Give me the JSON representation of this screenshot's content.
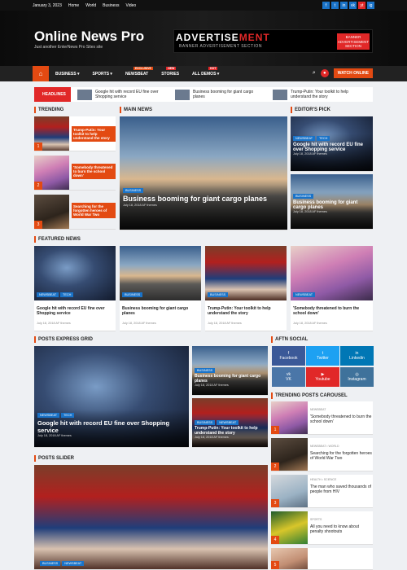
{
  "topbar": {
    "date": "January 3, 2023",
    "links": [
      "Home",
      "World",
      "Business",
      "Video"
    ],
    "social": [
      "f",
      "t",
      "in",
      "vk",
      "yt",
      "ig"
    ]
  },
  "header": {
    "site_title": "Online News Pro",
    "tagline": "Just another EnterNews Pro Sites site",
    "ad_title_a": "ADVERTISE",
    "ad_title_b": "MENT",
    "ad_sub": "BANNER ADVERTISEMENT SECTION",
    "ad_badge": "BANNER ADVERTISEMENT SECTION"
  },
  "nav": {
    "home_icon": "⌂",
    "items": [
      "BUSINESS",
      "SPORTS",
      "NEWSBEAT",
      "STORIES",
      "ALL DEMOS"
    ],
    "badges": {
      "exclusive": "EXCLUSIVE",
      "new": "NEW",
      "hot": "HOT"
    },
    "watch": "WATCH ONLINE"
  },
  "ticker": {
    "label": "HEADLINES",
    "items": [
      "Google hit with record EU fine over Shopping service",
      "Business booming for giant cargo planes",
      "Trump-Putin: Your toolkit to help understand the story"
    ]
  },
  "sections": {
    "trending": "TRENDING",
    "main": "MAIN NEWS",
    "editors": "EDITOR'S PICK",
    "featured": "FEATURED NEWS",
    "express": "POSTS EXPRESS GRID",
    "aftn": "AFTN SOCIAL",
    "carousel": "TRENDING POSTS CAROUSEL",
    "slider": "POSTS SLIDER"
  },
  "trending": [
    {
      "n": "1",
      "title": "Trump-Putin: Your toolkit to help understand the story"
    },
    {
      "n": "2",
      "title": "'Somebody threatened to burn the school down'"
    },
    {
      "n": "3",
      "title": "Searching for the forgotten heroes of World War Two"
    }
  ],
  "main": {
    "cat": "BUSINESS",
    "title": "Business booming for giant cargo planes",
    "meta": "July 18, 2018   AF themes"
  },
  "editors": [
    {
      "cats": [
        "NEWSBEAT",
        "TECH"
      ],
      "title": "Google hit with record EU fine over Shopping service",
      "meta": "July 18, 2018   AF themes"
    },
    {
      "cats": [
        "BUSINESS"
      ],
      "title": "Business booming for giant cargo planes",
      "meta": "July 18, 2018   AF themes"
    }
  ],
  "featured": [
    {
      "cats": [
        "NEWSBEAT",
        "TECH"
      ],
      "title": "Google hit with record EU fine over Shopping service",
      "meta": "July 18, 2018   AF themes"
    },
    {
      "cats": [
        "BUSINESS"
      ],
      "title": "Business booming for giant cargo planes",
      "meta": "July 18, 2018   AF themes"
    },
    {
      "cats": [
        "BUSINESS"
      ],
      "title": "Trump-Putin: Your toolkit to help understand the story",
      "meta": "July 18, 2018   AF themes"
    },
    {
      "cats": [
        "NEWSBEAT"
      ],
      "title": "'Somebody threatened to burn the school down'",
      "meta": "July 18, 2018   AF themes"
    }
  ],
  "express": {
    "big": {
      "cats": [
        "NEWSBEAT",
        "TECH"
      ],
      "title": "Google hit with record EU fine over Shopping service",
      "meta": "July 18, 2018   AF themes"
    },
    "small": [
      {
        "cats": [
          "BUSINESS"
        ],
        "title": "Business booming for giant cargo planes",
        "meta": "July 18, 2018   AF themes"
      },
      {
        "cats": [
          "BUSINESS",
          "NEWSBEAT"
        ],
        "title": "Trump-Putin: Your toolkit to help understand the story",
        "meta": "July 18, 2018   AF themes"
      }
    ]
  },
  "social_buttons": [
    {
      "label": "Facebook",
      "icon": "f",
      "color": "#3b5998"
    },
    {
      "label": "Twitter",
      "icon": "t",
      "color": "#1da1f2"
    },
    {
      "label": "Linkedin",
      "icon": "in",
      "color": "#0077b5"
    },
    {
      "label": "VK",
      "icon": "vk",
      "color": "#4a76a8"
    },
    {
      "label": "Youtube",
      "icon": "▶",
      "color": "#e12828"
    },
    {
      "label": "Instagram",
      "icon": "◎",
      "color": "#3f729b"
    }
  ],
  "carousel": [
    {
      "n": "1",
      "cats": "NEWSBEAT",
      "title": "'Somebody threatened to burn the school down'"
    },
    {
      "n": "2",
      "cats": "NEWSBEAT  •  WORLD",
      "title": "Searching for the forgotten heroes of World War Two"
    },
    {
      "n": "3",
      "cats": "HEALTH  •  SCIENCE",
      "title": "The man who saved thousands of people from HIV"
    },
    {
      "n": "4",
      "cats": "SPORTS",
      "title": "All you need to know about penalty shootouts"
    },
    {
      "n": "5",
      "cats": "",
      "title": ""
    }
  ],
  "slider": {
    "cats": [
      "BUSINESS",
      "NEWSBEAT"
    ]
  }
}
